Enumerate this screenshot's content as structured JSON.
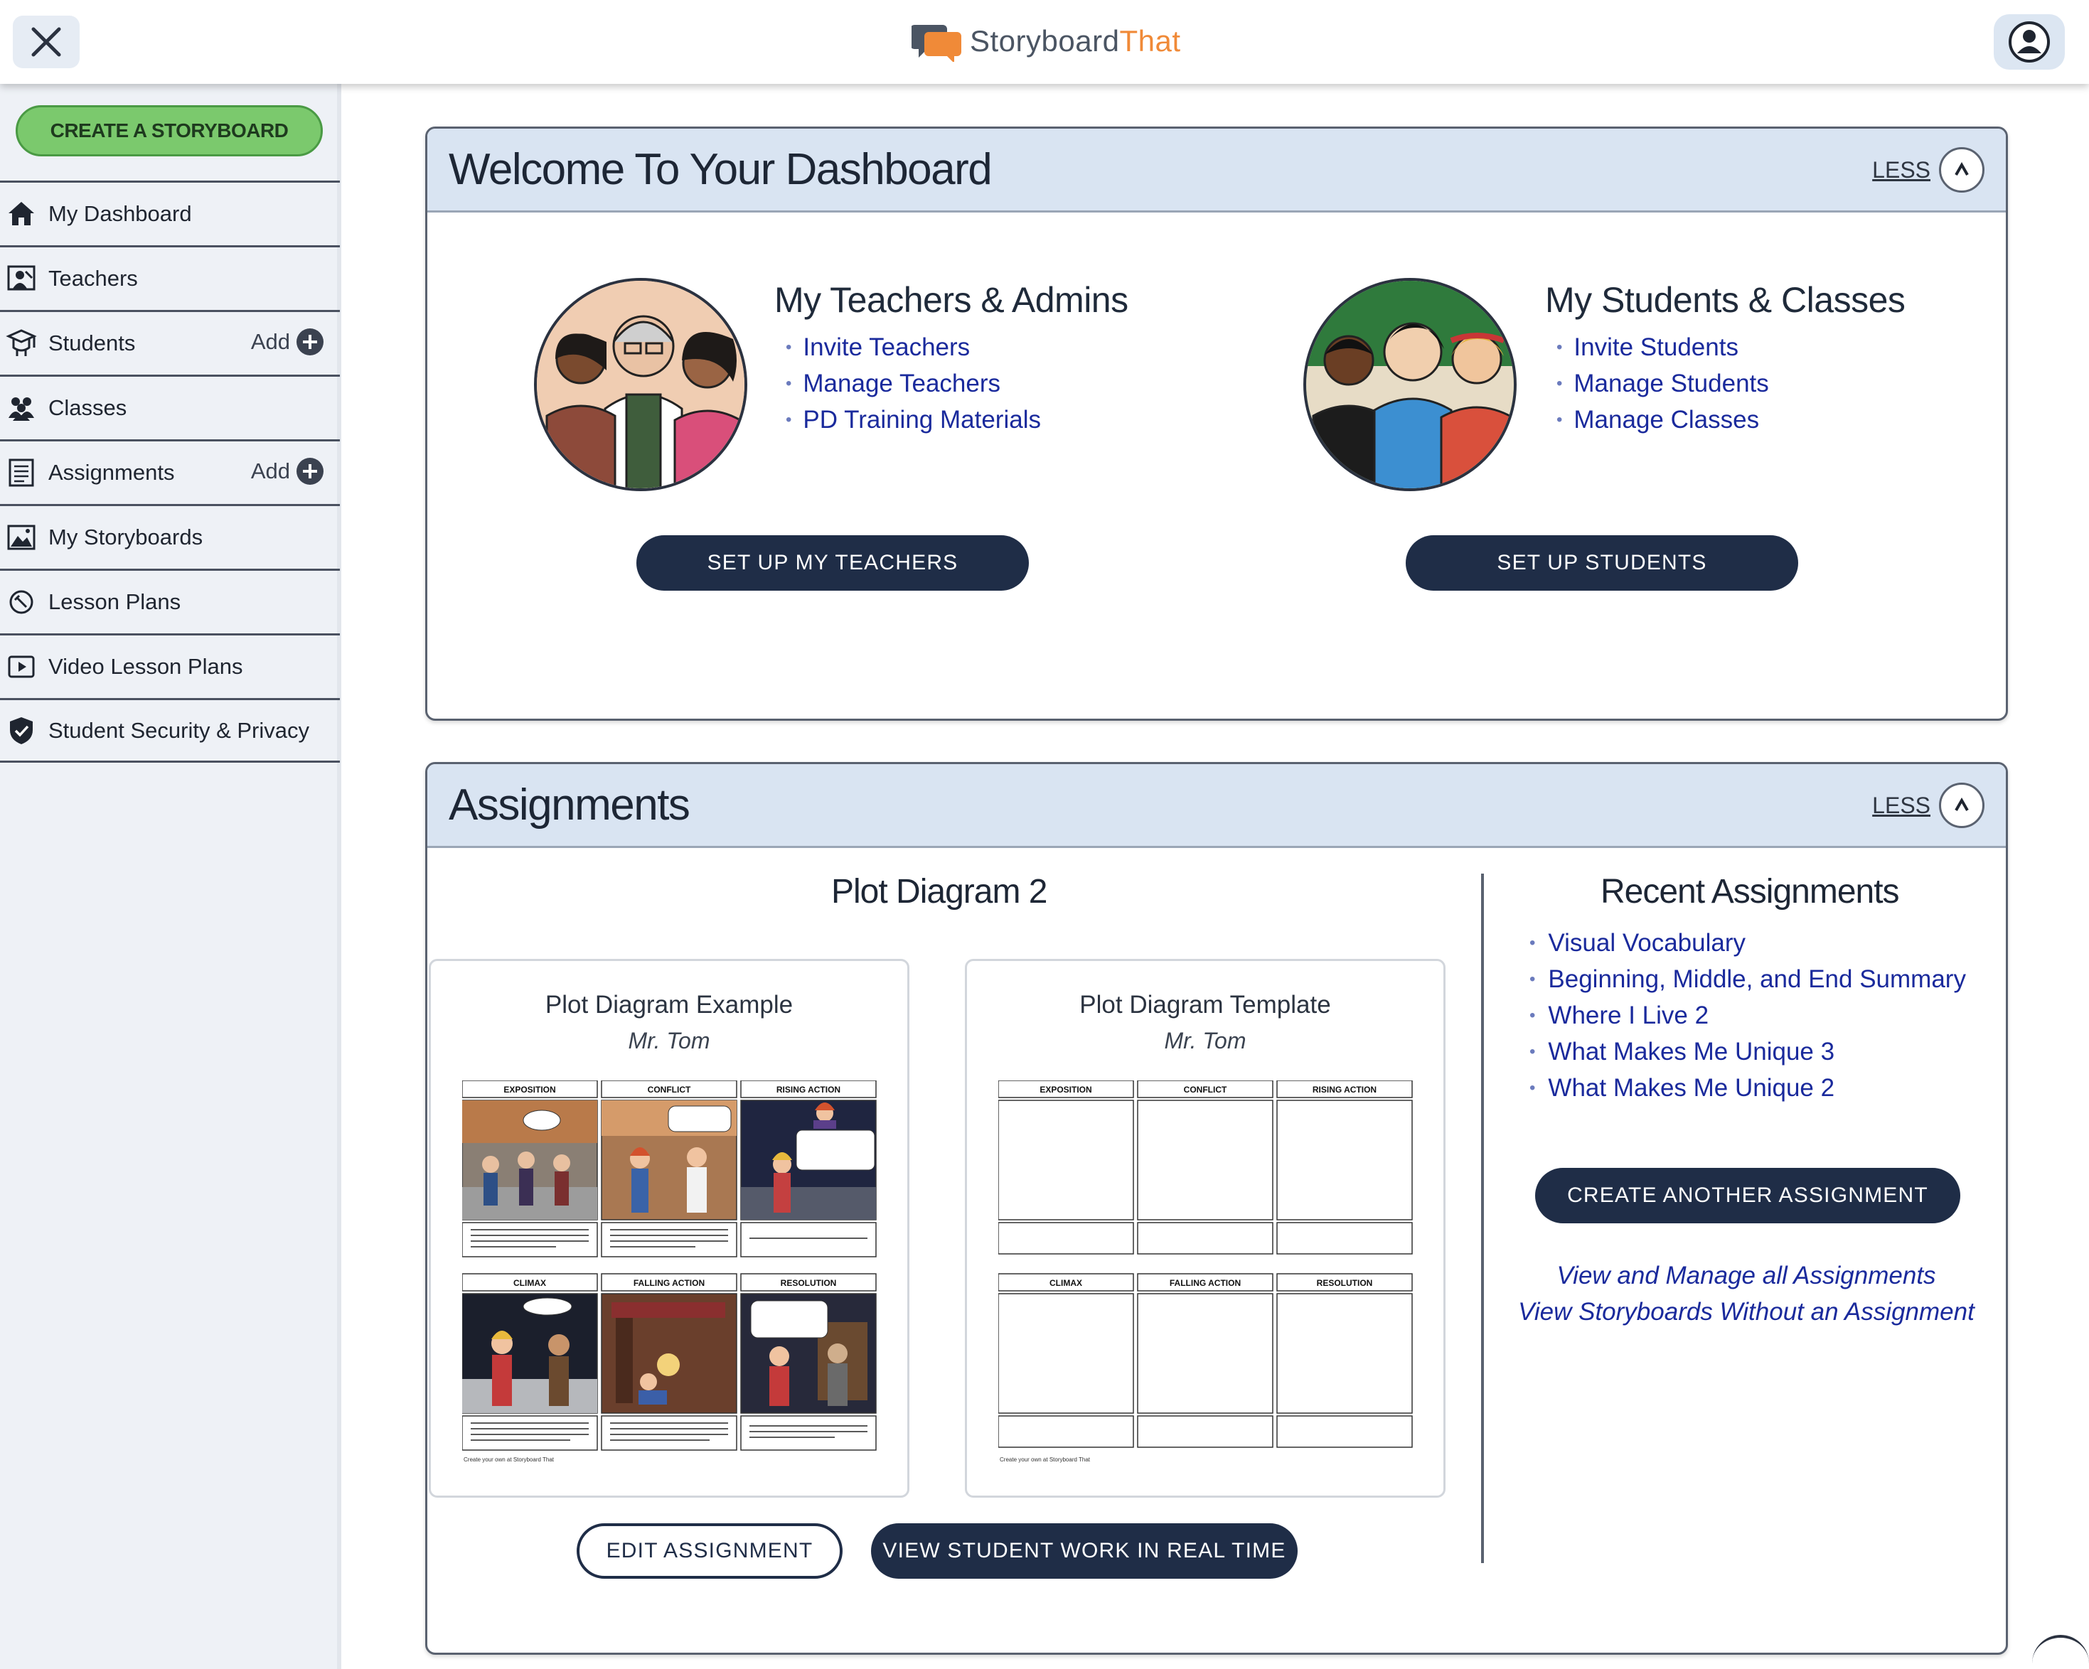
{
  "header": {
    "logo_part1": "Storyboard",
    "logo_part2": "That"
  },
  "colors": {
    "accent_dark": "#1f2d47",
    "create_green": "#7bc96d",
    "link_blue": "#1a2a9c",
    "logo_orange": "#f08a38",
    "panel_header": "#d9e4f2"
  },
  "sidebar": {
    "create_label": "CREATE A STORYBOARD",
    "items": [
      {
        "label": "My Dashboard",
        "icon": "home-icon",
        "add": null
      },
      {
        "label": "Teachers",
        "icon": "teacher-icon",
        "add": null
      },
      {
        "label": "Students",
        "icon": "student-icon",
        "add": "Add"
      },
      {
        "label": "Classes",
        "icon": "classes-icon",
        "add": null
      },
      {
        "label": "Assignments",
        "icon": "assignment-icon",
        "add": "Add"
      },
      {
        "label": "My Storyboards",
        "icon": "storyboard-image-icon",
        "add": null
      },
      {
        "label": "Lesson Plans",
        "icon": "lesson-plan-icon",
        "add": null
      },
      {
        "label": "Video Lesson Plans",
        "icon": "video-icon",
        "add": null
      },
      {
        "label": "Student Security & Privacy",
        "icon": "shield-icon",
        "add": null
      }
    ]
  },
  "welcome": {
    "title": "Welcome To Your Dashboard",
    "less_label": "LESS",
    "teachers": {
      "title": "My Teachers & Admins",
      "links": [
        "Invite Teachers",
        "Manage Teachers",
        "PD Training Materials"
      ],
      "button": "SET UP MY TEACHERS"
    },
    "students": {
      "title": "My Students & Classes",
      "links": [
        "Invite Students",
        "Manage Students",
        "Manage Classes"
      ],
      "button": "SET UP STUDENTS"
    }
  },
  "assignments": {
    "title": "Assignments",
    "less_label": "LESS",
    "current_title": "Plot Diagram 2",
    "cards": [
      {
        "title": "Plot Diagram Example",
        "author": "Mr. Tom"
      },
      {
        "title": "Plot Diagram Template",
        "author": "Mr. Tom"
      }
    ],
    "storyboard": {
      "headers_top": [
        "EXPOSITION",
        "CONFLICT",
        "RISING ACTION"
      ],
      "headers_bottom": [
        "CLIMAX",
        "FALLING ACTION",
        "RESOLUTION"
      ],
      "footer": "Create your own at Storyboard That"
    },
    "edit_button": "EDIT ASSIGNMENT",
    "view_button": "VIEW STUDENT WORK IN REAL TIME",
    "recent_title": "Recent Assignments",
    "recent": [
      "Visual Vocabulary",
      "Beginning, Middle, and End Summary",
      "Where I Live 2",
      "What Makes Me Unique 3",
      "What Makes Me Unique 2"
    ],
    "create_another": "CREATE ANOTHER ASSIGNMENT",
    "view_manage_all": "View and Manage all Assignments",
    "view_without": "View Storyboards Without an Assignment"
  }
}
